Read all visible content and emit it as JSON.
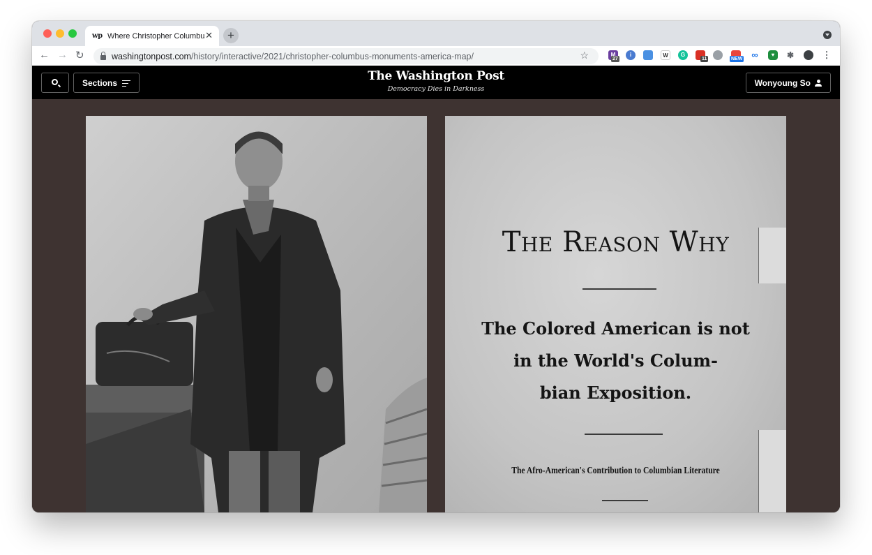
{
  "browser": {
    "tab_title": "Where Christopher Columbus r",
    "tab_favicon": "wp",
    "url_host": "washingtonpost.com",
    "url_path": "/history/interactive/2021/christopher-columbus-monuments-america-map/",
    "extension_badges": {
      "mail": "27",
      "calendar": "11",
      "new": "NEW"
    }
  },
  "site_header": {
    "sections_label": "Sections",
    "logo": "The Washington Post",
    "tagline": "Democracy Dies in Darkness",
    "user_name": "Wonyoung So"
  },
  "document_image": {
    "title": "The Reason Why",
    "subtitle_lines": [
      "The Colored American is not",
      "in the World's Colum-",
      "bian Exposition."
    ],
    "footer": "The Afro-American's Contribution to Columbian Literature"
  },
  "colors": {
    "page_background": "#3e3331",
    "header_background": "#000000",
    "tabbar": "#dee1e6"
  }
}
